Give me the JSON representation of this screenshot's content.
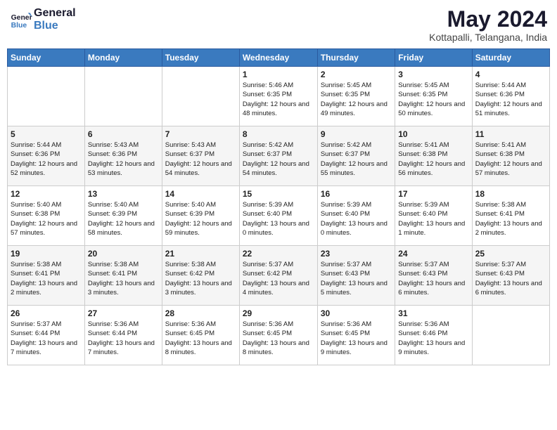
{
  "header": {
    "logo_line1": "General",
    "logo_line2": "Blue",
    "title": "May 2024",
    "subtitle": "Kottapalli, Telangana, India"
  },
  "weekdays": [
    "Sunday",
    "Monday",
    "Tuesday",
    "Wednesday",
    "Thursday",
    "Friday",
    "Saturday"
  ],
  "weeks": [
    [
      {
        "day": "",
        "sunrise": "",
        "sunset": "",
        "daylight": ""
      },
      {
        "day": "",
        "sunrise": "",
        "sunset": "",
        "daylight": ""
      },
      {
        "day": "",
        "sunrise": "",
        "sunset": "",
        "daylight": ""
      },
      {
        "day": "1",
        "sunrise": "Sunrise: 5:46 AM",
        "sunset": "Sunset: 6:35 PM",
        "daylight": "Daylight: 12 hours and 48 minutes."
      },
      {
        "day": "2",
        "sunrise": "Sunrise: 5:45 AM",
        "sunset": "Sunset: 6:35 PM",
        "daylight": "Daylight: 12 hours and 49 minutes."
      },
      {
        "day": "3",
        "sunrise": "Sunrise: 5:45 AM",
        "sunset": "Sunset: 6:35 PM",
        "daylight": "Daylight: 12 hours and 50 minutes."
      },
      {
        "day": "4",
        "sunrise": "Sunrise: 5:44 AM",
        "sunset": "Sunset: 6:36 PM",
        "daylight": "Daylight: 12 hours and 51 minutes."
      }
    ],
    [
      {
        "day": "5",
        "sunrise": "Sunrise: 5:44 AM",
        "sunset": "Sunset: 6:36 PM",
        "daylight": "Daylight: 12 hours and 52 minutes."
      },
      {
        "day": "6",
        "sunrise": "Sunrise: 5:43 AM",
        "sunset": "Sunset: 6:36 PM",
        "daylight": "Daylight: 12 hours and 53 minutes."
      },
      {
        "day": "7",
        "sunrise": "Sunrise: 5:43 AM",
        "sunset": "Sunset: 6:37 PM",
        "daylight": "Daylight: 12 hours and 54 minutes."
      },
      {
        "day": "8",
        "sunrise": "Sunrise: 5:42 AM",
        "sunset": "Sunset: 6:37 PM",
        "daylight": "Daylight: 12 hours and 54 minutes."
      },
      {
        "day": "9",
        "sunrise": "Sunrise: 5:42 AM",
        "sunset": "Sunset: 6:37 PM",
        "daylight": "Daylight: 12 hours and 55 minutes."
      },
      {
        "day": "10",
        "sunrise": "Sunrise: 5:41 AM",
        "sunset": "Sunset: 6:38 PM",
        "daylight": "Daylight: 12 hours and 56 minutes."
      },
      {
        "day": "11",
        "sunrise": "Sunrise: 5:41 AM",
        "sunset": "Sunset: 6:38 PM",
        "daylight": "Daylight: 12 hours and 57 minutes."
      }
    ],
    [
      {
        "day": "12",
        "sunrise": "Sunrise: 5:40 AM",
        "sunset": "Sunset: 6:38 PM",
        "daylight": "Daylight: 12 hours and 57 minutes."
      },
      {
        "day": "13",
        "sunrise": "Sunrise: 5:40 AM",
        "sunset": "Sunset: 6:39 PM",
        "daylight": "Daylight: 12 hours and 58 minutes."
      },
      {
        "day": "14",
        "sunrise": "Sunrise: 5:40 AM",
        "sunset": "Sunset: 6:39 PM",
        "daylight": "Daylight: 12 hours and 59 minutes."
      },
      {
        "day": "15",
        "sunrise": "Sunrise: 5:39 AM",
        "sunset": "Sunset: 6:40 PM",
        "daylight": "Daylight: 13 hours and 0 minutes."
      },
      {
        "day": "16",
        "sunrise": "Sunrise: 5:39 AM",
        "sunset": "Sunset: 6:40 PM",
        "daylight": "Daylight: 13 hours and 0 minutes."
      },
      {
        "day": "17",
        "sunrise": "Sunrise: 5:39 AM",
        "sunset": "Sunset: 6:40 PM",
        "daylight": "Daylight: 13 hours and 1 minute."
      },
      {
        "day": "18",
        "sunrise": "Sunrise: 5:38 AM",
        "sunset": "Sunset: 6:41 PM",
        "daylight": "Daylight: 13 hours and 2 minutes."
      }
    ],
    [
      {
        "day": "19",
        "sunrise": "Sunrise: 5:38 AM",
        "sunset": "Sunset: 6:41 PM",
        "daylight": "Daylight: 13 hours and 2 minutes."
      },
      {
        "day": "20",
        "sunrise": "Sunrise: 5:38 AM",
        "sunset": "Sunset: 6:41 PM",
        "daylight": "Daylight: 13 hours and 3 minutes."
      },
      {
        "day": "21",
        "sunrise": "Sunrise: 5:38 AM",
        "sunset": "Sunset: 6:42 PM",
        "daylight": "Daylight: 13 hours and 3 minutes."
      },
      {
        "day": "22",
        "sunrise": "Sunrise: 5:37 AM",
        "sunset": "Sunset: 6:42 PM",
        "daylight": "Daylight: 13 hours and 4 minutes."
      },
      {
        "day": "23",
        "sunrise": "Sunrise: 5:37 AM",
        "sunset": "Sunset: 6:43 PM",
        "daylight": "Daylight: 13 hours and 5 minutes."
      },
      {
        "day": "24",
        "sunrise": "Sunrise: 5:37 AM",
        "sunset": "Sunset: 6:43 PM",
        "daylight": "Daylight: 13 hours and 6 minutes."
      },
      {
        "day": "25",
        "sunrise": "Sunrise: 5:37 AM",
        "sunset": "Sunset: 6:43 PM",
        "daylight": "Daylight: 13 hours and 6 minutes."
      }
    ],
    [
      {
        "day": "26",
        "sunrise": "Sunrise: 5:37 AM",
        "sunset": "Sunset: 6:44 PM",
        "daylight": "Daylight: 13 hours and 7 minutes."
      },
      {
        "day": "27",
        "sunrise": "Sunrise: 5:36 AM",
        "sunset": "Sunset: 6:44 PM",
        "daylight": "Daylight: 13 hours and 7 minutes."
      },
      {
        "day": "28",
        "sunrise": "Sunrise: 5:36 AM",
        "sunset": "Sunset: 6:45 PM",
        "daylight": "Daylight: 13 hours and 8 minutes."
      },
      {
        "day": "29",
        "sunrise": "Sunrise: 5:36 AM",
        "sunset": "Sunset: 6:45 PM",
        "daylight": "Daylight: 13 hours and 8 minutes."
      },
      {
        "day": "30",
        "sunrise": "Sunrise: 5:36 AM",
        "sunset": "Sunset: 6:45 PM",
        "daylight": "Daylight: 13 hours and 9 minutes."
      },
      {
        "day": "31",
        "sunrise": "Sunrise: 5:36 AM",
        "sunset": "Sunset: 6:46 PM",
        "daylight": "Daylight: 13 hours and 9 minutes."
      },
      {
        "day": "",
        "sunrise": "",
        "sunset": "",
        "daylight": ""
      }
    ]
  ]
}
